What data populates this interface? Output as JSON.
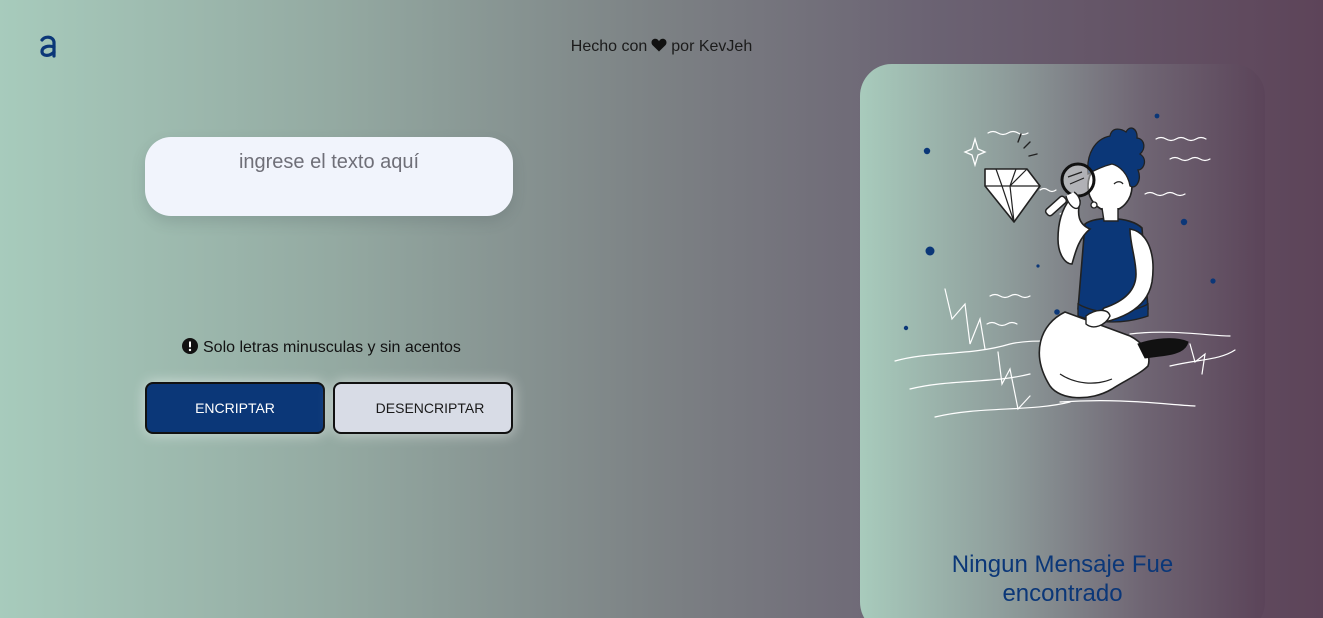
{
  "header": {
    "logo_letter": "a",
    "credit_prefix": "Hecho con",
    "credit_suffix": "por KevJeh"
  },
  "input": {
    "placeholder": "ingrese el texto aquí",
    "value": ""
  },
  "hint": {
    "text": "Solo letras minusculas y sin acentos"
  },
  "buttons": {
    "encrypt_label": "ENCRIPTAR",
    "decrypt_label": "DESENCRIPTAR"
  },
  "output_panel": {
    "message_line1": "Ningun Mensaje Fue",
    "message_line2": "encontrado"
  },
  "colors": {
    "accent": "#0b3778",
    "input_bg": "#f1f4fc",
    "decrypt_bg": "#d8dce6"
  },
  "icons": {
    "logo": "alura-logo-icon",
    "heart": "heart-icon",
    "hint": "exclamation-circle-icon"
  }
}
